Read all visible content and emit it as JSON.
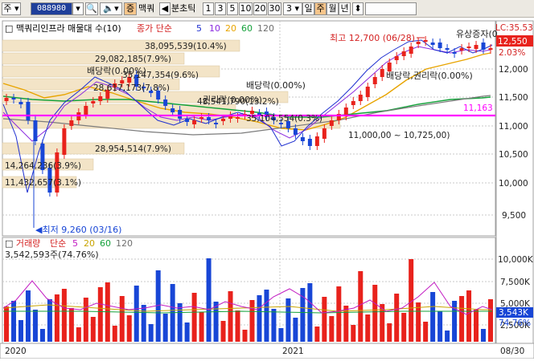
{
  "toolbar": {
    "mode": "주",
    "code": "088980",
    "name": "맥쿼",
    "rights_button": "증",
    "tool_label": "분초틱",
    "intervals": [
      "1",
      "3",
      "5",
      "10",
      "20",
      "30"
    ],
    "count": "3",
    "periods": [
      "일",
      "주",
      "월",
      "년"
    ],
    "selected_period": "주"
  },
  "legend": {
    "title": "맥쿼리인프라 매물대 수(10)",
    "ma_label": "종가 단순",
    "ma_periods": [
      "5",
      "10",
      "20",
      "60",
      "120"
    ],
    "ma_colors": [
      "#1e2fd0",
      "#8a2ae0",
      "#e8a400",
      "#13a13a",
      "#6e6e6e"
    ]
  },
  "top_right": {
    "lc": "LC:35.53",
    "last_price": "12,550",
    "change": "2.03%"
  },
  "annotations": {
    "high": "최고 12,700 (06/28)",
    "low": "최저 9,260 (03/16)",
    "rights_issue": "유상증자(0",
    "dividend_rights": "배당락,권리락(0.00%)",
    "dividend_1": "배당락(0.00%)",
    "dividend_2": "배당락(0.00%)",
    "rights_1": "권리락(0.00%)",
    "current_line": "11,163"
  },
  "volume_profile": [
    "38,095,539(10.4%)",
    "29,082,185(7.9%)",
    "35,147,354(9.6%)",
    "28,617,173(7.8%)",
    "48,541,790(13.2%)",
    "35,104,554(0.3%)",
    "11,000,00 ~ 10,725,00)",
    "28,954,514(7.9%)",
    "14,264,236(3.9%)",
    "11,432,657(3.1%)"
  ],
  "price_axis": [
    "12,000",
    "11,500",
    "11,000",
    "10,500",
    "10,000",
    "9,500"
  ],
  "volume_panel": {
    "title": "거래량",
    "ma_label": "단순",
    "ma_periods": [
      "5",
      "20",
      "60",
      "120"
    ],
    "current": "3,542,593주(74.76%)",
    "axis": [
      "10,000K",
      "7,500K",
      "5,000K",
      "2,500K"
    ],
    "last_tag": "3,543K",
    "ratio": "74.76%"
  },
  "date_axis": {
    "start": "2020",
    "mid": "2021",
    "end": "08/30"
  },
  "colors": {
    "up": "#e8221c",
    "down": "#1846d6",
    "mark_line": "#ff00ff",
    "profile": "#f3e4c7"
  }
}
